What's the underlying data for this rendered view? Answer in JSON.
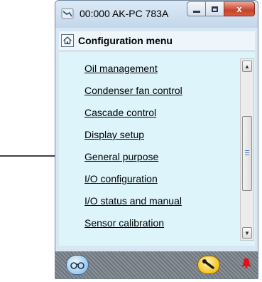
{
  "window": {
    "title": "00:000 AK-PC 783A"
  },
  "window_buttons": {
    "close_glyph": "x"
  },
  "menu": {
    "title": "Configuration menu",
    "items": [
      {
        "label": "Oil management"
      },
      {
        "label": "Condenser fan control"
      },
      {
        "label": "Cascade control"
      },
      {
        "label": "Display setup"
      },
      {
        "label": "General purpose"
      },
      {
        "label": "I/O configuration"
      },
      {
        "label": "I/O status and manual"
      },
      {
        "label": "Sensor calibration"
      }
    ]
  },
  "annotation": {
    "points_to": "General purpose"
  },
  "icons": {
    "app": "connection-icon",
    "home": "home-icon",
    "status_left": "glasses-icon",
    "status_middle": "wrench-icon",
    "status_right": "alarm-bell-icon"
  },
  "colors": {
    "content_bg": "#ddf4fb",
    "close_button": "#c6442c",
    "wrench_button": "#f3c21f",
    "alarm_bell": "#e3101a"
  }
}
